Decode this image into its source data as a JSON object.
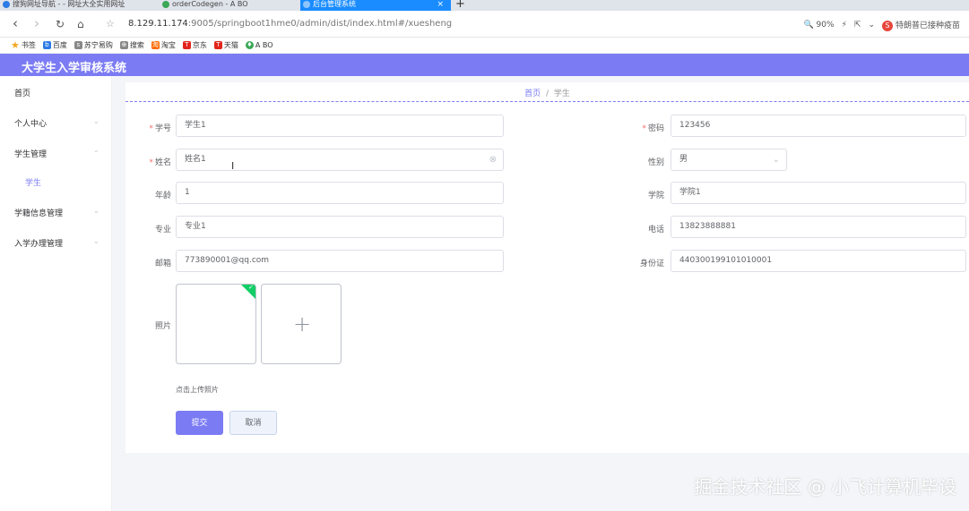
{
  "browser": {
    "tabs": [
      {
        "label": "搜狗网址导航 - - 网址大全实用网址",
        "color": "#2d7be5"
      },
      {
        "label": "orderCodegen - A BO",
        "color": "#3aa856"
      },
      {
        "label": "后台管理系统",
        "color": "#ffffff",
        "active": true
      }
    ],
    "new_tab": "+",
    "url_host": "8.129.11.174",
    "url_path": ":9005/springboot1hme0/admin/dist/index.html#/xuesheng",
    "zoom": "90%",
    "news_text": "特朗普已接种疫苗",
    "bookmarks": [
      {
        "label": "书签",
        "icon": "star-icon",
        "color": "#f5a623"
      },
      {
        "label": "百度",
        "icon": "baidu-icon",
        "color": "#2d7be5"
      },
      {
        "label": "苏宁易购",
        "icon": "suning-icon",
        "color": "#888888"
      },
      {
        "label": "搜索",
        "icon": "search-icon",
        "color": "#888888"
      },
      {
        "label": "淘宝",
        "icon": "taobao-icon",
        "color": "#ff6a00"
      },
      {
        "label": "京东",
        "icon": "jd-icon",
        "color": "#e1251b"
      },
      {
        "label": "天猫",
        "icon": "tmall-icon",
        "color": "#e1251b"
      },
      {
        "label": "A BO",
        "icon": "abo-icon",
        "color": "#3aa856"
      }
    ]
  },
  "app": {
    "title": "大学生入学审核系统",
    "accent": "#7b7bf4"
  },
  "sidebar": {
    "items": [
      {
        "label": "首页"
      },
      {
        "label": "个人中心"
      },
      {
        "label": "学生管理"
      },
      {
        "label": "学生"
      },
      {
        "label": "学籍信息管理"
      },
      {
        "label": "入学办理管理"
      }
    ]
  },
  "breadcrumb": {
    "home": "首页",
    "sep": "/",
    "current": "学生"
  },
  "form": {
    "xuehao": {
      "label": "学号",
      "value": "学生1"
    },
    "mima": {
      "label": "密码",
      "value": "123456"
    },
    "xingming": {
      "label": "姓名",
      "value": "姓名1"
    },
    "xingbie": {
      "label": "性别",
      "value": "男"
    },
    "nianling": {
      "label": "年龄",
      "value": "1"
    },
    "xueyuan": {
      "label": "学院",
      "value": "学院1"
    },
    "zhuanye": {
      "label": "专业",
      "value": "专业1"
    },
    "dianhua": {
      "label": "电话",
      "value": "13823888881"
    },
    "youxiang": {
      "label": "邮箱",
      "value": "773890001@qq.com"
    },
    "shenfenzheng": {
      "label": "身份证",
      "value": "440300199101010001"
    },
    "zhaopian": {
      "label": "照片"
    },
    "upload_tip": "点击上传照片",
    "submit": "提交",
    "cancel": "取消"
  },
  "watermark": "掘金技术社区 @ 小飞计算机毕设"
}
